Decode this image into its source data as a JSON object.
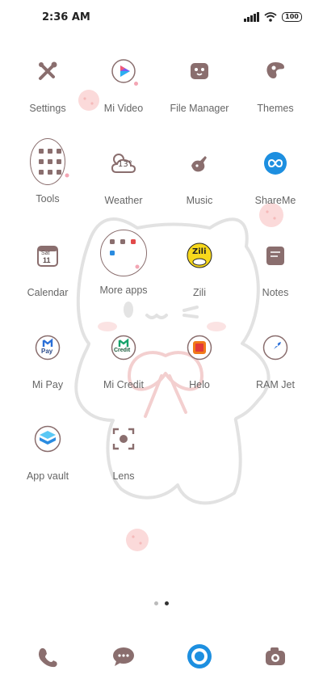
{
  "status": {
    "time": "2:36 AM",
    "battery": "100"
  },
  "apps": [
    {
      "label": "Settings",
      "icon": "settings-icon"
    },
    {
      "label": "Mi Video",
      "icon": "mi-video-icon"
    },
    {
      "label": "File Manager",
      "icon": "file-manager-icon"
    },
    {
      "label": "Themes",
      "icon": "themes-icon"
    },
    {
      "label": "Tools",
      "icon": "tools-folder-icon"
    },
    {
      "label": "Weather",
      "icon": "weather-icon",
      "temp": "13°"
    },
    {
      "label": "Music",
      "icon": "music-icon"
    },
    {
      "label": "ShareMe",
      "icon": "shareme-icon"
    },
    {
      "label": "Calendar",
      "icon": "calendar-icon",
      "day": "Sat",
      "date": "11"
    },
    {
      "label": "More apps",
      "icon": "more-apps-folder-icon"
    },
    {
      "label": "Zili",
      "icon": "zili-icon",
      "brand": "Zili"
    },
    {
      "label": "Notes",
      "icon": "notes-icon"
    },
    {
      "label": "Mi Pay",
      "icon": "mi-pay-icon",
      "sub": "Pay"
    },
    {
      "label": "Mi Credit",
      "icon": "mi-credit-icon",
      "sub": "Credit"
    },
    {
      "label": "Helo",
      "icon": "helo-icon"
    },
    {
      "label": "RAM Jet",
      "icon": "ram-jet-icon"
    },
    {
      "label": "App vault",
      "icon": "app-vault-icon"
    },
    {
      "label": "Lens",
      "icon": "lens-icon"
    }
  ],
  "dock": [
    {
      "icon": "phone-icon"
    },
    {
      "icon": "messaging-icon"
    },
    {
      "icon": "browser-icon"
    },
    {
      "icon": "camera-icon"
    }
  ],
  "pages": {
    "count": 2,
    "active": 2
  },
  "colors": {
    "icon_brown": "#8a6e6e",
    "accent_pink": "#f3a6b4",
    "background": "#ffffff"
  }
}
